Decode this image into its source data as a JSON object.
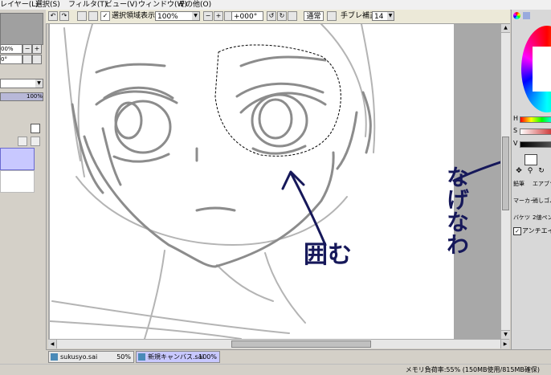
{
  "menu": {
    "layer": "レイヤー(L)",
    "select": "選択(S)",
    "filter": "フィルタ(T)",
    "view": "ビュー(V)",
    "window": "ウィンドウ(W)",
    "other": "その他(O)"
  },
  "toolbar": {
    "show_selection_label": "選択領域表示",
    "zoom_value": "100%",
    "rotation_value": "+000°",
    "blend_mode": "通常",
    "stabilizer_label": "手ブレ補正",
    "stabilizer_value": "14"
  },
  "left_panel": {
    "zoom_text": "00%",
    "angle_text": "0°",
    "opacity_text": "100%"
  },
  "right_panel": {
    "h_label": "H",
    "s_label": "S",
    "v_label": "V",
    "tools": [
      "鉛筆",
      "エアブラシ",
      "マーカー",
      "消しゴム",
      "バケツ",
      "2値ペン"
    ],
    "antialias_label": "アンチエイリアス",
    "colors": {
      "hue_ring": "#ff0000",
      "value_bar": "#222222"
    }
  },
  "canvas": {
    "annotation_enclose": "囲む",
    "annotation_lasso": "なげなわ",
    "annotation_color": "#16185a"
  },
  "tabs": [
    {
      "name": "sukusyo.sai",
      "zoom": "50%"
    },
    {
      "name": "新規キャンバス.sai",
      "zoom": "100%"
    }
  ],
  "status": {
    "memory": "メモリ負荷率:55% (150MB使用/815MB確保)"
  }
}
